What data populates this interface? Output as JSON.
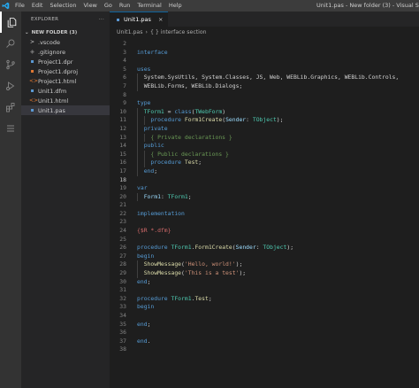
{
  "titlebar": {
    "menu": [
      "File",
      "Edit",
      "Selection",
      "View",
      "Go",
      "Run",
      "Terminal",
      "Help"
    ],
    "window_title": "Unit1.pas - New folder (3) - Visual Stu"
  },
  "sidebar": {
    "header": "EXPLORER",
    "more": "···",
    "folder": "NEW FOLDER (3)",
    "items": [
      {
        "label": ".vscode",
        "icon": ">",
        "color": "#cccccc"
      },
      {
        "label": ".gitignore",
        "icon": "◈",
        "color": "#858585"
      },
      {
        "label": "Project1.dpr",
        "icon": "▪",
        "color": "#5c9bd6"
      },
      {
        "label": "Project1.dproj",
        "icon": "▪",
        "color": "#e37933"
      },
      {
        "label": "Project1.html",
        "icon": "<>",
        "color": "#e37933"
      },
      {
        "label": "Unit1.dfm",
        "icon": "▪",
        "color": "#5c9bd6"
      },
      {
        "label": "Unit1.html",
        "icon": "<>",
        "color": "#e37933"
      },
      {
        "label": "Unit1.pas",
        "icon": "▪",
        "color": "#5c9bd6"
      }
    ]
  },
  "editor": {
    "tab_label": "Unit1.pas",
    "tab_close": "×",
    "breadcrumb": [
      "Unit1.pas",
      "{ } interface section"
    ],
    "active_line": 18,
    "lines": [
      {
        "n": "2",
        "indent": 0,
        "tokens": []
      },
      {
        "n": "3",
        "indent": 0,
        "tokens": [
          {
            "t": "interface",
            "c": "kw"
          }
        ]
      },
      {
        "n": "4",
        "indent": 0,
        "tokens": []
      },
      {
        "n": "5",
        "indent": 0,
        "tokens": [
          {
            "t": "uses",
            "c": "kw"
          }
        ]
      },
      {
        "n": "6",
        "indent": 1,
        "tokens": [
          {
            "t": "  System.SysUtils, System.Classes, JS, Web, WEBLib.Graphics, WEBLib.Controls,",
            "c": "pl"
          }
        ]
      },
      {
        "n": "7",
        "indent": 1,
        "tokens": [
          {
            "t": "  WEBLib.Forms, WEBLib.Dialogs;",
            "c": "pl"
          }
        ]
      },
      {
        "n": "8",
        "indent": 0,
        "tokens": []
      },
      {
        "n": "9",
        "indent": 0,
        "tokens": [
          {
            "t": "type",
            "c": "kw"
          }
        ]
      },
      {
        "n": "10",
        "indent": 1,
        "tokens": [
          {
            "t": "  TForm1",
            "c": "ty"
          },
          {
            "t": " = ",
            "c": "pl"
          },
          {
            "t": "class",
            "c": "kw"
          },
          {
            "t": "(",
            "c": "pl"
          },
          {
            "t": "TWebForm",
            "c": "ty"
          },
          {
            "t": ")",
            "c": "pl"
          }
        ]
      },
      {
        "n": "11",
        "indent": 2,
        "tokens": [
          {
            "t": "    procedure ",
            "c": "kw"
          },
          {
            "t": "Form1Create",
            "c": "fn"
          },
          {
            "t": "(",
            "c": "pl"
          },
          {
            "t": "Sender",
            "c": "id"
          },
          {
            "t": ": ",
            "c": "pl"
          },
          {
            "t": "TObject",
            "c": "ty"
          },
          {
            "t": ");",
            "c": "pl"
          }
        ]
      },
      {
        "n": "12",
        "indent": 1,
        "tokens": [
          {
            "t": "  private",
            "c": "kw"
          }
        ]
      },
      {
        "n": "13",
        "indent": 2,
        "tokens": [
          {
            "t": "    { Private declarations }",
            "c": "cm"
          }
        ]
      },
      {
        "n": "14",
        "indent": 1,
        "tokens": [
          {
            "t": "  public",
            "c": "kw"
          }
        ]
      },
      {
        "n": "15",
        "indent": 2,
        "tokens": [
          {
            "t": "    { Public declarations }",
            "c": "cm"
          }
        ]
      },
      {
        "n": "16",
        "indent": 2,
        "tokens": [
          {
            "t": "    procedure ",
            "c": "kw"
          },
          {
            "t": "Test",
            "c": "fn"
          },
          {
            "t": ";",
            "c": "pl"
          }
        ]
      },
      {
        "n": "17",
        "indent": 1,
        "tokens": [
          {
            "t": "  end",
            "c": "kw"
          },
          {
            "t": ";",
            "c": "pl"
          }
        ]
      },
      {
        "n": "18",
        "indent": 0,
        "tokens": []
      },
      {
        "n": "19",
        "indent": 0,
        "tokens": [
          {
            "t": "var",
            "c": "kw"
          }
        ]
      },
      {
        "n": "20",
        "indent": 1,
        "tokens": [
          {
            "t": "  Form1",
            "c": "id"
          },
          {
            "t": ": ",
            "c": "pl"
          },
          {
            "t": "TForm1",
            "c": "ty"
          },
          {
            "t": ";",
            "c": "pl"
          }
        ]
      },
      {
        "n": "21",
        "indent": 0,
        "tokens": []
      },
      {
        "n": "22",
        "indent": 0,
        "tokens": [
          {
            "t": "implementation",
            "c": "kw"
          }
        ]
      },
      {
        "n": "23",
        "indent": 0,
        "tokens": []
      },
      {
        "n": "24",
        "indent": 0,
        "tokens": [
          {
            "t": "{$R *.dfm}",
            "c": "dir"
          }
        ]
      },
      {
        "n": "25",
        "indent": 0,
        "tokens": []
      },
      {
        "n": "26",
        "indent": 0,
        "tokens": [
          {
            "t": "procedure ",
            "c": "kw"
          },
          {
            "t": "TForm1",
            "c": "ty"
          },
          {
            "t": ".",
            "c": "pl"
          },
          {
            "t": "Form1Create",
            "c": "fn"
          },
          {
            "t": "(",
            "c": "pl"
          },
          {
            "t": "Sender",
            "c": "id"
          },
          {
            "t": ": ",
            "c": "pl"
          },
          {
            "t": "TObject",
            "c": "ty"
          },
          {
            "t": ");",
            "c": "pl"
          }
        ]
      },
      {
        "n": "27",
        "indent": 0,
        "tokens": [
          {
            "t": "begin",
            "c": "kw"
          }
        ]
      },
      {
        "n": "28",
        "indent": 1,
        "tokens": [
          {
            "t": "  ShowMessage",
            "c": "fn"
          },
          {
            "t": "(",
            "c": "pl"
          },
          {
            "t": "'Hello, world!'",
            "c": "str"
          },
          {
            "t": ");",
            "c": "pl"
          }
        ]
      },
      {
        "n": "29",
        "indent": 1,
        "tokens": [
          {
            "t": "  ShowMessage",
            "c": "fn"
          },
          {
            "t": "(",
            "c": "pl"
          },
          {
            "t": "'This is a test'",
            "c": "str"
          },
          {
            "t": ");",
            "c": "pl"
          }
        ]
      },
      {
        "n": "30",
        "indent": 0,
        "tokens": [
          {
            "t": "end",
            "c": "kw"
          },
          {
            "t": ";",
            "c": "pl"
          }
        ]
      },
      {
        "n": "31",
        "indent": 0,
        "tokens": []
      },
      {
        "n": "32",
        "indent": 0,
        "tokens": [
          {
            "t": "procedure ",
            "c": "kw"
          },
          {
            "t": "TForm1",
            "c": "ty"
          },
          {
            "t": ".",
            "c": "pl"
          },
          {
            "t": "Test",
            "c": "fn"
          },
          {
            "t": ";",
            "c": "pl"
          }
        ]
      },
      {
        "n": "33",
        "indent": 0,
        "tokens": [
          {
            "t": "begin",
            "c": "kw"
          }
        ]
      },
      {
        "n": "34",
        "indent": 0,
        "tokens": []
      },
      {
        "n": "35",
        "indent": 0,
        "tokens": [
          {
            "t": "end",
            "c": "kw"
          },
          {
            "t": ";",
            "c": "pl"
          }
        ]
      },
      {
        "n": "36",
        "indent": 0,
        "tokens": []
      },
      {
        "n": "37",
        "indent": 0,
        "tokens": [
          {
            "t": "end",
            "c": "kw"
          },
          {
            "t": ".",
            "c": "pl"
          }
        ]
      },
      {
        "n": "38",
        "indent": 0,
        "tokens": []
      }
    ]
  },
  "activitybar": {
    "icons": [
      "explorer-icon",
      "search-icon",
      "source-control-icon",
      "run-debug-icon",
      "extensions-icon",
      "remote-explorer-icon"
    ]
  },
  "colors": {
    "accent": "#007acc",
    "vscode_logo": "#23a9f2"
  }
}
